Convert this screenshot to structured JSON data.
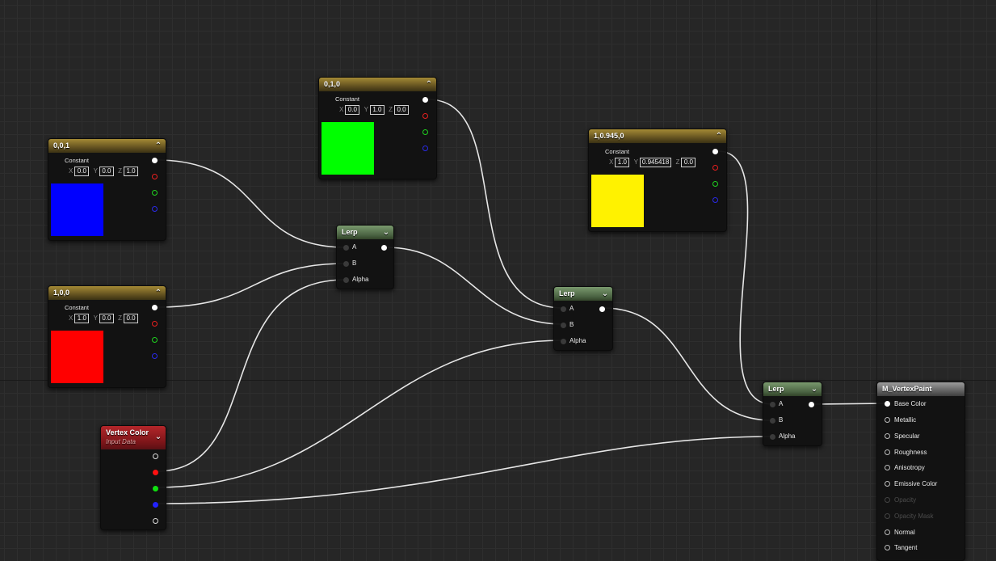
{
  "nodes": {
    "blue": {
      "title": "0,0,1",
      "type": "Constant",
      "x": "0.0",
      "y": "0.0",
      "z": "1.0",
      "color": "#0000ff"
    },
    "red": {
      "title": "1,0,0",
      "type": "Constant",
      "x": "1.0",
      "y": "0.0",
      "z": "0.0",
      "color": "#ff0000"
    },
    "green": {
      "title": "0,1,0",
      "type": "Constant",
      "x": "0.0",
      "y": "1.0",
      "z": "0.0",
      "color": "#00ff00"
    },
    "yellow": {
      "title": "1,0.945,0",
      "type": "Constant",
      "x": "1.0",
      "y": "0.945418",
      "z": "0.0",
      "color": "#fff200"
    },
    "lerp1": {
      "title": "Lerp",
      "pins": [
        "A",
        "B",
        "Alpha"
      ]
    },
    "lerp2": {
      "title": "Lerp",
      "pins": [
        "A",
        "B",
        "Alpha"
      ]
    },
    "lerp3": {
      "title": "Lerp",
      "pins": [
        "A",
        "B",
        "Alpha"
      ]
    },
    "vertex_color": {
      "title": "Vertex Color",
      "subtitle": "Input Data"
    },
    "material": {
      "title": "M_VertexPaint",
      "pins": [
        "Base Color",
        "Metallic",
        "Specular",
        "Roughness",
        "Anisotropy",
        "Emissive Color",
        "Opacity",
        "Opacity Mask",
        "Normal",
        "Tangent"
      ]
    }
  },
  "axis_labels": {
    "x": "X",
    "y": "Y",
    "z": "Z"
  },
  "icons": {
    "collapse": "chevron-up-icon",
    "expand": "chevron-down-icon"
  }
}
